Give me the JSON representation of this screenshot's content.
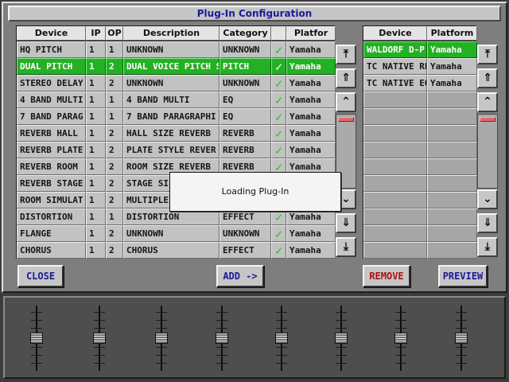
{
  "window": {
    "title": "Plug-In Configuration"
  },
  "left_table": {
    "headers": [
      "Device",
      "IP",
      "OP",
      "Description",
      "Category",
      "",
      "Platfor"
    ],
    "rows": [
      {
        "device": "HQ PITCH",
        "ip": "1",
        "op": "1",
        "description": "UNKNOWN",
        "category": "UNKNOWN",
        "check": "✓",
        "platform": "Yamaha",
        "selected": false
      },
      {
        "device": "DUAL PITCH",
        "ip": "1",
        "op": "2",
        "description": "DUAL VOICE PITCH S",
        "category": "PITCH",
        "check": "✓",
        "platform": "Yamaha",
        "selected": true
      },
      {
        "device": "STEREO DELAY",
        "ip": "1",
        "op": "2",
        "description": "UNKNOWN",
        "category": "UNKNOWN",
        "check": "✓",
        "platform": "Yamaha",
        "selected": false
      },
      {
        "device": "4 BAND MULTI",
        "ip": "1",
        "op": "1",
        "description": "4 BAND MULTI",
        "category": "EQ",
        "check": "✓",
        "platform": "Yamaha",
        "selected": false
      },
      {
        "device": "7 BAND PARAG",
        "ip": "1",
        "op": "1",
        "description": "7 BAND PARAGRAPHI",
        "category": "EQ",
        "check": "✓",
        "platform": "Yamaha",
        "selected": false
      },
      {
        "device": "REVERB HALL",
        "ip": "1",
        "op": "2",
        "description": "HALL SIZE REVERB",
        "category": "REVERB",
        "check": "✓",
        "platform": "Yamaha",
        "selected": false
      },
      {
        "device": "REVERB PLATE",
        "ip": "1",
        "op": "2",
        "description": "PLATE STYLE REVER",
        "category": "REVERB",
        "check": "✓",
        "platform": "Yamaha",
        "selected": false
      },
      {
        "device": "REVERB ROOM",
        "ip": "1",
        "op": "2",
        "description": "ROOM SIZE REVERB",
        "category": "REVERB",
        "check": "✓",
        "platform": "Yamaha",
        "selected": false
      },
      {
        "device": "REVERB STAGE",
        "ip": "1",
        "op": "2",
        "description": "STAGE SI",
        "category": "",
        "check": "",
        "platform": "",
        "selected": false
      },
      {
        "device": "ROOM SIMULAT",
        "ip": "1",
        "op": "2",
        "description": "MULTIPLE",
        "category": "",
        "check": "",
        "platform": "",
        "selected": false
      },
      {
        "device": "DISTORTION",
        "ip": "1",
        "op": "1",
        "description": "DISTORTION",
        "category": "EFFECT",
        "check": "✓",
        "platform": "Yamaha",
        "selected": false
      },
      {
        "device": "FLANGE",
        "ip": "1",
        "op": "2",
        "description": "UNKNOWN",
        "category": "UNKNOWN",
        "check": "✓",
        "platform": "Yamaha",
        "selected": false
      },
      {
        "device": "CHORUS",
        "ip": "1",
        "op": "2",
        "description": "CHORUS",
        "category": "EFFECT",
        "check": "✓",
        "platform": "Yamaha",
        "selected": false
      }
    ]
  },
  "right_table": {
    "headers": [
      "Device",
      "Platform"
    ],
    "rows": [
      {
        "device": "WALDORF D-P",
        "platform": "Yamaha",
        "selected": true
      },
      {
        "device": "TC NATIVE RE",
        "platform": "Yamaha",
        "selected": false
      },
      {
        "device": "TC NATIVE EQ",
        "platform": "Yamaha",
        "selected": false
      }
    ],
    "empty_rows": 10
  },
  "scroll_glyphs": {
    "top": "⤒",
    "page_up": "⇑",
    "up": "⌃",
    "down": "⌄",
    "page_down": "⇓",
    "bottom": "⤓"
  },
  "buttons": {
    "close": "CLOSE",
    "add": "ADD ->",
    "remove": "REMOVE",
    "preview": "PREVIEW"
  },
  "colors": {
    "accent_blue": "#1a1a9a",
    "remove_red": "#b01010",
    "selection_green": "#24b024"
  },
  "loading_dialog": {
    "message": "Loading Plug-In"
  },
  "mixer": {
    "fader_count": 8
  }
}
